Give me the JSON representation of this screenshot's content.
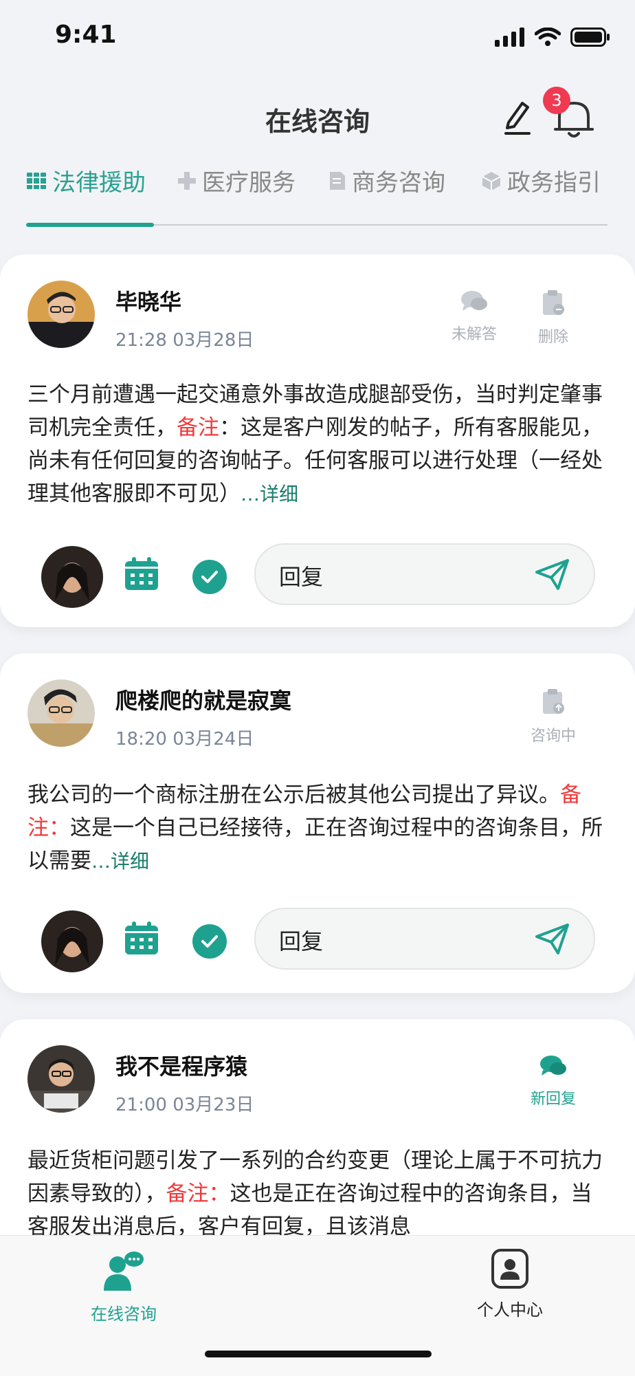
{
  "status_bar": {
    "time": "9:41"
  },
  "header": {
    "title": "在线咨询",
    "notification_count": "3"
  },
  "tabs": [
    {
      "label": "法律援助",
      "icon": "book-icon",
      "active": true
    },
    {
      "label": "医疗服务",
      "icon": "plus-icon",
      "active": false
    },
    {
      "label": "商务咨询",
      "icon": "document-icon",
      "active": false
    },
    {
      "label": "政务指引",
      "icon": "cube-icon",
      "active": false
    }
  ],
  "posts": [
    {
      "author": "毕晓华",
      "time": "21:28 03月28日",
      "actions": [
        {
          "label": "未解答",
          "icon": "chat-bubbles-icon"
        },
        {
          "label": "删除",
          "icon": "clipboard-delete-icon"
        }
      ],
      "content_before": "三个月前遭遇一起交通意外事故造成腿部受伤，当时判定肇事司机完全责任，",
      "note_label": "备注",
      "content_after": "：这是客户刚发的帖子，所有客服能见，尚未有任何回复的咨询帖子。任何客服可以进行处理（一经处理其他客服即不可见）",
      "more_label": "…详细",
      "reply_label": "回复"
    },
    {
      "author": "爬楼爬的就是寂寞",
      "time": "18:20  03月24日",
      "actions": [
        {
          "label": "咨询中",
          "icon": "clipboard-upload-icon"
        }
      ],
      "content_before": "我公司的一个商标注册在公示后被其他公司提出了异议。",
      "note_label": "备注：",
      "content_after": "这是一个自己已经接待，正在咨询过程中的咨询条目，所以需要",
      "more_label": "…详细",
      "reply_label": "回复"
    },
    {
      "author": "我不是程序猿",
      "time": "21:00 03月23日",
      "actions": [
        {
          "label": "新回复",
          "icon": "chat-bubbles-icon"
        }
      ],
      "content_before": "最近货柜问题引发了一系列的合约变更（理论上属于不可抗力因素导致的），",
      "note_label": "备注：",
      "content_after": "这也是正在咨询过程中的咨询条目，当客服发出消息后，客户有回复，且该消息"
    }
  ],
  "bottom_nav": [
    {
      "label": "在线咨询",
      "icon": "consult-person-icon",
      "active": true
    },
    {
      "label": "个人中心",
      "icon": "profile-icon",
      "active": false
    }
  ],
  "colors": {
    "accent": "#1ea28f",
    "note": "#ef3a3a",
    "badge": "#ef3a52"
  }
}
